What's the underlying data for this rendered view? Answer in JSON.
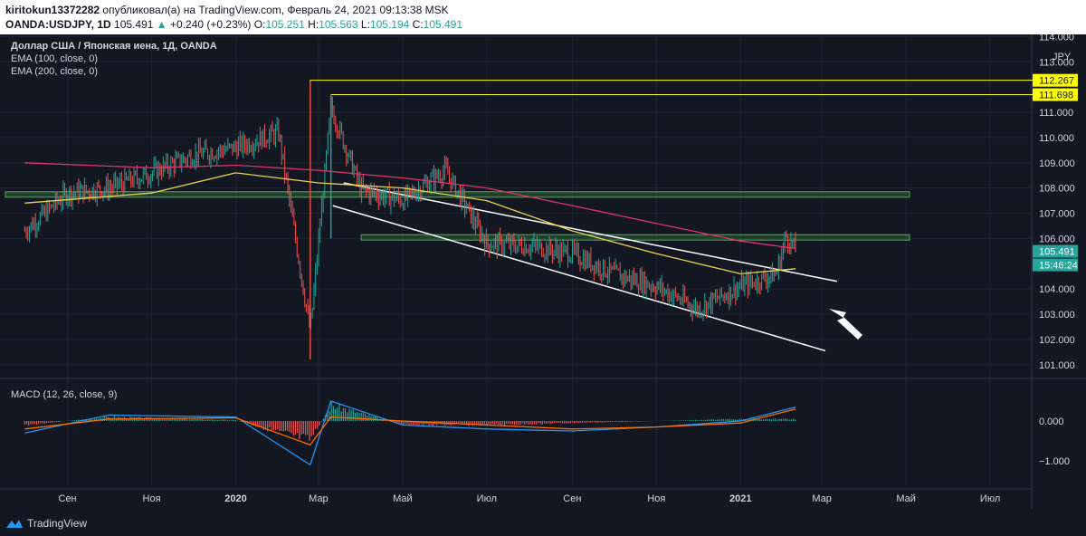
{
  "header": {
    "author": "kiritokun13372282",
    "published": "опубликовал(а) на TradingView.com, Февраль 24, 2021 09:13:38 MSK",
    "symbol": "OANDA:USDJPY, 1D",
    "last": "105.491",
    "change_arrow": "▲",
    "change": "+0.240 (+0.23%)",
    "open_label": "O:",
    "open": "105.251",
    "high_label": "H:",
    "high": "105.563",
    "low_label": "L:",
    "low": "105.194",
    "close_label": "C:",
    "close": "105.491"
  },
  "legend": {
    "title": "Доллар США / Японская иена, 1Д, OANDA",
    "ema100": "EMA (100, close, 0)",
    "ema200": "EMA (200, close, 0)",
    "macd": "MACD (12, 26, close, 9)"
  },
  "footer": {
    "brand": "TradingView"
  },
  "colors": {
    "background": "#131722",
    "up": "#26a69a",
    "down": "#ef5350",
    "ema100": "#e8d44d",
    "ema200": "#e0336a",
    "macd_line": "#2196f3",
    "signal_line": "#ff6d00",
    "resistance_line": "#ffff00",
    "zone": "#4caf50",
    "trendline": "#ffffff"
  },
  "chart_data": {
    "type": "candlestick",
    "currency_label": "JPY",
    "price_axis": {
      "ticks": [
        "114.000",
        "113.000",
        "111.000",
        "110.000",
        "109.000",
        "108.000",
        "107.000",
        "106.000",
        "104.000",
        "103.000",
        "102.000",
        "101.000"
      ],
      "range": [
        100.8,
        114.0
      ]
    },
    "time_axis": {
      "ticks": [
        "Сен",
        "Ноя",
        "2020",
        "Мар",
        "Май",
        "Июл",
        "Сен",
        "Ноя",
        "2021",
        "Мар",
        "Май",
        "Июл"
      ]
    },
    "price_series": [
      {
        "date": "2019-08",
        "close": 106.3
      },
      {
        "date": "2019-09",
        "close": 107.8
      },
      {
        "date": "2019-10",
        "close": 108.0
      },
      {
        "date": "2019-11",
        "close": 108.6
      },
      {
        "date": "2019-12",
        "close": 109.3
      },
      {
        "date": "2020-01",
        "close": 109.6
      },
      {
        "date": "2020-02",
        "close": 110.2
      },
      {
        "date": "2020-03-09",
        "close": 102.3
      },
      {
        "date": "2020-03-24",
        "close": 111.2
      },
      {
        "date": "2020-04",
        "close": 107.9
      },
      {
        "date": "2020-05",
        "close": 107.5
      },
      {
        "date": "2020-06",
        "close": 108.7
      },
      {
        "date": "2020-07",
        "close": 105.8
      },
      {
        "date": "2020-08",
        "close": 105.7
      },
      {
        "date": "2020-09",
        "close": 105.4
      },
      {
        "date": "2020-10",
        "close": 104.6
      },
      {
        "date": "2020-11",
        "close": 104.1
      },
      {
        "date": "2020-12",
        "close": 103.2
      },
      {
        "date": "2021-01",
        "close": 104.1
      },
      {
        "date": "2021-02-10",
        "close": 104.6
      },
      {
        "date": "2021-02-17",
        "close": 106.1
      },
      {
        "date": "2021-02-24",
        "close": 105.491
      }
    ],
    "ema100": [
      {
        "date": "2019-08",
        "value": 107.4
      },
      {
        "date": "2019-11",
        "value": 107.8
      },
      {
        "date": "2020-01",
        "value": 108.6
      },
      {
        "date": "2020-03",
        "value": 108.2
      },
      {
        "date": "2020-05",
        "value": 108.0
      },
      {
        "date": "2020-07",
        "value": 107.5
      },
      {
        "date": "2020-09",
        "value": 106.3
      },
      {
        "date": "2020-11",
        "value": 105.4
      },
      {
        "date": "2021-01",
        "value": 104.6
      },
      {
        "date": "2021-02-24",
        "value": 104.8
      }
    ],
    "ema200": [
      {
        "date": "2019-08",
        "value": 109.0
      },
      {
        "date": "2019-11",
        "value": 108.8
      },
      {
        "date": "2020-01",
        "value": 108.9
      },
      {
        "date": "2020-03",
        "value": 108.7
      },
      {
        "date": "2020-05",
        "value": 108.4
      },
      {
        "date": "2020-07",
        "value": 108.0
      },
      {
        "date": "2020-09",
        "value": 107.3
      },
      {
        "date": "2020-11",
        "value": 106.6
      },
      {
        "date": "2021-01",
        "value": 105.9
      },
      {
        "date": "2021-02-24",
        "value": 105.6
      }
    ],
    "price_labels": [
      {
        "value": "112.267",
        "color": "#ffff00"
      },
      {
        "value": "111.698",
        "color": "#ffff00"
      },
      {
        "value": "105.491",
        "color": "#26a69a"
      },
      {
        "value": "15:46:24",
        "color": "#26a69a"
      }
    ],
    "horizontal_lines": [
      112.267,
      111.698
    ],
    "zones": [
      [
        107.7,
        107.85
      ],
      [
        106.0,
        106.15
      ]
    ],
    "macd_axis": {
      "ticks": [
        "0.000",
        "−1.000"
      ],
      "range": [
        -1.3,
        0.55
      ]
    },
    "macd": [
      {
        "date": "2019-08",
        "macd": -0.3,
        "signal": -0.2
      },
      {
        "date": "2019-10",
        "macd": 0.15,
        "signal": 0.05
      },
      {
        "date": "2020-01",
        "macd": 0.1,
        "signal": 0.08
      },
      {
        "date": "2020-03-09",
        "macd": -1.1,
        "signal": -0.6
      },
      {
        "date": "2020-03-24",
        "macd": 0.5,
        "signal": 0.1
      },
      {
        "date": "2020-05",
        "macd": -0.1,
        "signal": 0.0
      },
      {
        "date": "2020-07",
        "macd": -0.2,
        "signal": -0.1
      },
      {
        "date": "2020-09",
        "macd": -0.25,
        "signal": -0.2
      },
      {
        "date": "2020-11",
        "macd": -0.15,
        "signal": -0.15
      },
      {
        "date": "2021-01",
        "macd": 0.0,
        "signal": -0.05
      },
      {
        "date": "2021-02-24",
        "macd": 0.35,
        "signal": 0.3
      }
    ],
    "grid": true
  }
}
